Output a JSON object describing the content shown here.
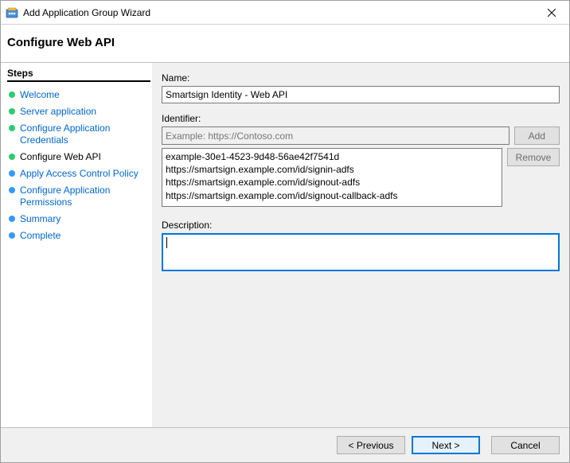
{
  "window": {
    "title": "Add Application Group Wizard",
    "close_label": "Close"
  },
  "header": {
    "title": "Configure Web API"
  },
  "steps": {
    "heading": "Steps",
    "items": [
      {
        "label": "Welcome",
        "state": "done"
      },
      {
        "label": "Server application",
        "state": "done"
      },
      {
        "label": "Configure Application Credentials",
        "state": "done"
      },
      {
        "label": "Configure Web API",
        "state": "current"
      },
      {
        "label": "Apply Access Control Policy",
        "state": "future"
      },
      {
        "label": "Configure Application Permissions",
        "state": "future"
      },
      {
        "label": "Summary",
        "state": "future"
      },
      {
        "label": "Complete",
        "state": "future"
      }
    ]
  },
  "form": {
    "name_label": "Name:",
    "name_value": "Smartsign Identity - Web API",
    "identifier_label": "Identifier:",
    "identifier_placeholder": "Example: https://Contoso.com",
    "identifier_value": "",
    "add_button": "Add",
    "remove_button": "Remove",
    "identifiers": [
      "example-30e1-4523-9d48-56ae42f7541d",
      "https://smartsign.example.com/id/signin-adfs",
      "https://smartsign.example.com/id/signout-adfs",
      "https://smartsign.example.com/id/signout-callback-adfs"
    ],
    "description_label": "Description:",
    "description_value": ""
  },
  "footer": {
    "previous": "< Previous",
    "next": "Next >",
    "cancel": "Cancel"
  }
}
